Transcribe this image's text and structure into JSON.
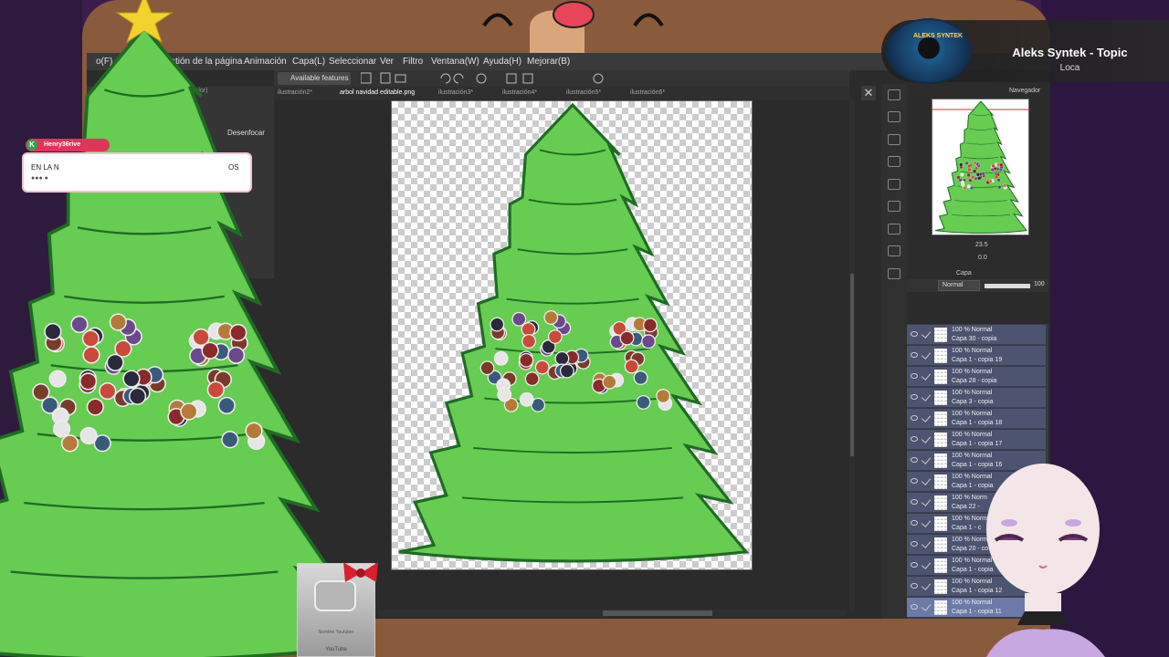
{
  "menu": [
    "stión de la página",
    "Animación",
    "Capa(L)",
    "Seleccionar",
    "Ver",
    "Filtro",
    "Ventana(W)",
    "Ayuda(H)",
    "Mejorar(B)"
  ],
  "menu_prefix": "o(F)",
  "toolbar": {
    "available_features": "Available features"
  },
  "tabs": [
    "ilustración2*",
    "arbol navidad editable.png",
    "ilustración3*",
    "ilustración4*",
    "ilustración5*",
    "ilustración6*"
  ],
  "tool_panel": {
    "blur_label": "Desenfocar",
    "color_label": "color)"
  },
  "navigator": {
    "label": "Navegador",
    "zoom": "23.5",
    "rotation": "0.0"
  },
  "layers": {
    "tab_label": "Capa",
    "blend_mode": "Normal",
    "opacity": "100",
    "items": [
      {
        "line1": "100 % Normal",
        "line2": "Capa 30 - copia"
      },
      {
        "line1": "100 % Normal",
        "line2": "Capa 1 - copia 19"
      },
      {
        "line1": "100 % Normal",
        "line2": "Capa 28 - copia"
      },
      {
        "line1": "100 % Normal",
        "line2": "Capa 3 - copia"
      },
      {
        "line1": "100 % Normal",
        "line2": "Capa 1 - copia 18"
      },
      {
        "line1": "100 % Normal",
        "line2": "Capa 1 - copia 17"
      },
      {
        "line1": "100 % Normal",
        "line2": "Capa 1 - copia 16"
      },
      {
        "line1": "100 % Normal",
        "line2": "Capa 1 - copia"
      },
      {
        "line1": "100 % Norm",
        "line2": "Capa 22 -"
      },
      {
        "line1": "100 % Norm",
        "line2": "Capa 1 - c"
      },
      {
        "line1": "100 % Norm",
        "line2": "Capa 20 - co"
      },
      {
        "line1": "100 % Normal",
        "line2": "Capa 1 - copia"
      },
      {
        "line1": "100 % Normal",
        "line2": "Capa 1 - copia 12"
      },
      {
        "line1": "100 % Normal",
        "line2": "Capa 1 - copia 11"
      }
    ]
  },
  "now_playing": {
    "title": "Aleks Syntek - Topic",
    "subtitle": "Loca",
    "album_text": "ALEKS SYNTEK"
  },
  "chat": {
    "user": "Henry36rive",
    "badge": "K",
    "text_start": "EN LA N",
    "text_end": "OS",
    "dots": "●●● ●"
  },
  "plaque": {
    "text": "Nombre Youtuber",
    "brand": "YouTube"
  },
  "colors": {
    "tree": "#66cc52",
    "tree_outline": "#1f6b24",
    "app_bg": "#2b2b2b",
    "layer_selected": "#6c7aa8"
  }
}
